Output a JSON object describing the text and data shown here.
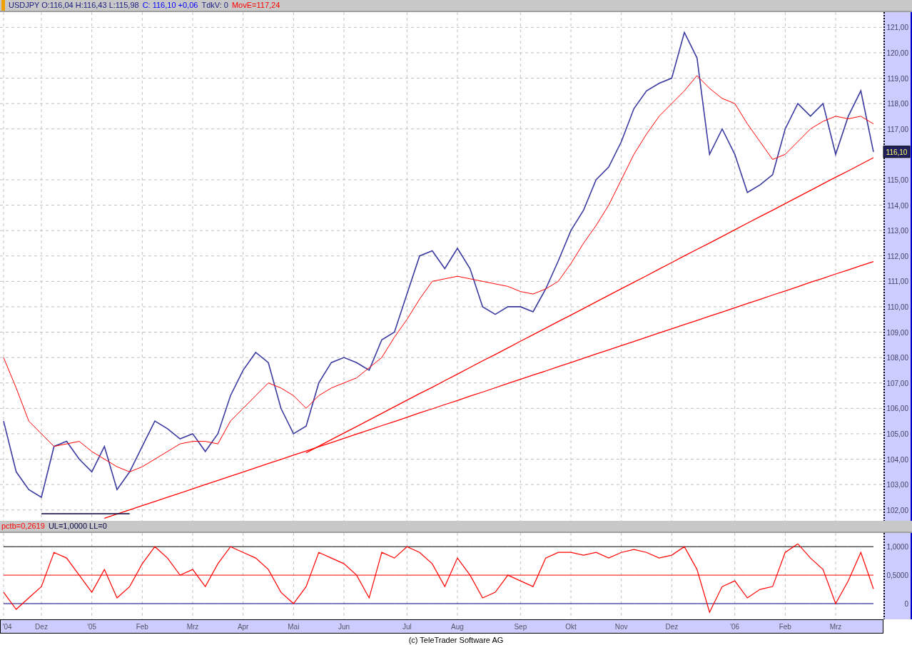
{
  "header": {
    "items": [
      {
        "text": "USDJPY O:116,04 H:116,43 L:115,98",
        "color": "#202080"
      },
      {
        "text": "C: 116,10 +0,06",
        "color": "#0000ff"
      },
      {
        "text": "TdkV: 0",
        "color": "#202080"
      },
      {
        "text": "MovE=117,24",
        "color": "#ff0000"
      }
    ]
  },
  "price_panel": {
    "last_price_tag": "116,10",
    "chart_data": {
      "type": "line",
      "grid": true,
      "series": [
        {
          "color": "#3a3aa0",
          "values": [
            105.5,
            103.5,
            102.8,
            102.5,
            104.5,
            104.7,
            104.0,
            103.5,
            104.5,
            102.8,
            103.5,
            104.5,
            105.5,
            105.2,
            104.8,
            105.0,
            104.3,
            105.0,
            106.5,
            107.5,
            108.2,
            107.8,
            106.0,
            105.0,
            105.3,
            107.0,
            107.8,
            108.0,
            107.8,
            107.5,
            108.7,
            109.0,
            110.5,
            112.0,
            112.2,
            111.5,
            112.3,
            111.5,
            110.0,
            109.7,
            110.0,
            110.0,
            109.8,
            110.7,
            111.8,
            113.0,
            113.8,
            115.0,
            115.5,
            116.5,
            117.8,
            118.5,
            118.8,
            119.0,
            120.8,
            119.8,
            116.0,
            117.0,
            116.0,
            114.5,
            114.8,
            115.2,
            117.0,
            118.0,
            117.5,
            118.0,
            116.0,
            117.5,
            118.5,
            116.1
          ]
        },
        {
          "color": "#ff0000",
          "values": [
            108,
            106.8,
            105.5,
            105,
            104.5,
            104.6,
            104.7,
            104.3,
            104,
            103.7,
            103.5,
            103.7,
            104,
            104.3,
            104.6,
            104.7,
            104.7,
            104.6,
            105.5,
            106,
            106.5,
            107,
            106.8,
            106.5,
            106,
            106.5,
            106.8,
            107,
            107.2,
            107.6,
            108,
            108.8,
            109.5,
            110.3,
            111,
            111.1,
            111.2,
            111.1,
            111,
            110.9,
            110.8,
            110.6,
            110.5,
            110.7,
            111,
            111.7,
            112.5,
            113.2,
            114,
            115,
            116,
            116.8,
            117.5,
            118,
            118.5,
            119.1,
            118.6,
            118.2,
            118,
            117.2,
            116.5,
            115.8,
            116,
            116.5,
            117,
            117.3,
            117.5,
            117.4,
            117.5,
            117.2
          ]
        },
        {
          "color": "#ff0000",
          "values": [
            null,
            null,
            null,
            null,
            null,
            null,
            null,
            null,
            101.67,
            101.84,
            102.0,
            102.17,
            102.33,
            102.5,
            102.66,
            102.83,
            103.0,
            103.16,
            103.33,
            103.49,
            103.66,
            103.83,
            103.99,
            104.16,
            104.32,
            104.49,
            104.65,
            104.82,
            104.99,
            105.15,
            105.32,
            105.48,
            105.65,
            105.82,
            105.98,
            106.15,
            106.31,
            106.48,
            106.64,
            106.81,
            106.98,
            107.14,
            107.31,
            107.47,
            107.64,
            107.8,
            107.97,
            108.14,
            108.3,
            108.47,
            108.63,
            108.8,
            108.97,
            109.13,
            109.3,
            109.46,
            109.63,
            109.79,
            109.96,
            110.13,
            110.29,
            110.46,
            110.62,
            110.79,
            110.96,
            111.12,
            111.29,
            111.45,
            111.62,
            111.78
          ]
        },
        {
          "color": "#ff0000",
          "values": [
            null,
            null,
            null,
            null,
            null,
            null,
            null,
            null,
            null,
            null,
            null,
            null,
            null,
            null,
            null,
            null,
            null,
            null,
            null,
            null,
            null,
            null,
            null,
            null,
            104.25,
            104.51,
            104.77,
            105.03,
            105.28,
            105.54,
            105.8,
            106.06,
            106.32,
            106.58,
            106.83,
            107.09,
            107.35,
            107.61,
            107.87,
            108.12,
            108.38,
            108.64,
            108.9,
            109.16,
            109.42,
            109.67,
            109.93,
            110.19,
            110.45,
            110.71,
            110.96,
            111.22,
            111.48,
            111.74,
            112.0,
            112.26,
            112.51,
            112.77,
            113.03,
            113.29,
            113.55,
            113.8,
            114.06,
            114.32,
            114.58,
            114.84,
            115.1,
            115.35,
            115.61,
            115.87
          ]
        },
        {
          "color": "#000040",
          "values": [
            null,
            null,
            null,
            101.85,
            101.85,
            101.85,
            101.85,
            101.85,
            101.85,
            101.85,
            101.85,
            null,
            null,
            null,
            null,
            null,
            null,
            null,
            null,
            null,
            null,
            null,
            null,
            null,
            null,
            null,
            null,
            null,
            null,
            null,
            null,
            null,
            null,
            null,
            null,
            null,
            null,
            null,
            null,
            null,
            null,
            null,
            null,
            null,
            null,
            null,
            null,
            null,
            null,
            null,
            null,
            null,
            null,
            null,
            null,
            null,
            null,
            null,
            null,
            null,
            null,
            null,
            null,
            null,
            null,
            null,
            null,
            null,
            null,
            null
          ]
        }
      ],
      "ylim": [
        101.57,
        121.6
      ],
      "yticks": [
        {
          "value": 102,
          "label": "102,00"
        },
        {
          "value": 103,
          "label": "103,00"
        },
        {
          "value": 104,
          "label": "104,00"
        },
        {
          "value": 105,
          "label": "105,00"
        },
        {
          "value": 106,
          "label": "106,00"
        },
        {
          "value": 107,
          "label": "107,00"
        },
        {
          "value": 108,
          "label": "108,00"
        },
        {
          "value": 109,
          "label": "109,00"
        },
        {
          "value": 110,
          "label": "110,00"
        },
        {
          "value": 111,
          "label": "111,00"
        },
        {
          "value": 112,
          "label": "112,00"
        },
        {
          "value": 113,
          "label": "113,00"
        },
        {
          "value": 114,
          "label": "114,00"
        },
        {
          "value": 115,
          "label": "115,00"
        },
        {
          "value": 117,
          "label": "117,00"
        },
        {
          "value": 118,
          "label": "118,00"
        },
        {
          "value": 119,
          "label": "119,00"
        },
        {
          "value": 120,
          "label": "120,00"
        },
        {
          "value": 121,
          "label": "121,00"
        }
      ]
    }
  },
  "indicator_header": {
    "items": [
      {
        "text": "pctb=0,2619",
        "color": "#ff0000"
      },
      {
        "text": "UL=1,0000 LL=0",
        "color": "#000040"
      }
    ]
  },
  "indicator_panel": {
    "chart_data": {
      "type": "line",
      "grid": true,
      "categories": [
        "'04",
        null,
        null,
        "Dez",
        null,
        null,
        null,
        "'05",
        null,
        null,
        null,
        "Feb",
        null,
        null,
        null,
        "Mrz",
        null,
        null,
        null,
        "Apr",
        null,
        null,
        null,
        "Mai",
        null,
        null,
        null,
        "Jun",
        null,
        null,
        null,
        null,
        "Jul",
        null,
        null,
        null,
        "Aug",
        null,
        null,
        null,
        null,
        "Sep",
        null,
        null,
        null,
        "Okt",
        null,
        null,
        null,
        "Nov",
        null,
        null,
        null,
        "Dez",
        null,
        null,
        null,
        null,
        "'06",
        null,
        null,
        null,
        "Feb",
        null,
        null,
        null,
        "Mrz",
        null,
        null,
        null
      ],
      "series": [
        {
          "color": "#ff0000",
          "values": [
            0.2,
            -0.1,
            0.1,
            0.3,
            0.9,
            0.8,
            0.5,
            0.2,
            0.6,
            0.1,
            0.3,
            0.7,
            1.0,
            0.8,
            0.5,
            0.6,
            0.3,
            0.7,
            1.0,
            0.9,
            0.8,
            0.6,
            0.2,
            0.0,
            0.3,
            0.9,
            0.8,
            0.7,
            0.5,
            0.1,
            0.9,
            0.8,
            1.0,
            0.9,
            0.7,
            0.3,
            0.8,
            0.5,
            0.1,
            0.2,
            0.5,
            0.4,
            0.3,
            0.8,
            0.9,
            0.9,
            0.85,
            0.9,
            0.8,
            0.9,
            0.95,
            0.9,
            0.8,
            0.85,
            1.0,
            0.6,
            -0.15,
            0.3,
            0.4,
            0.1,
            0.25,
            0.3,
            0.9,
            1.05,
            0.8,
            0.6,
            0.0,
            0.4,
            0.9,
            0.26
          ]
        },
        {
          "color": "#000000",
          "values": [
            1,
            1,
            1,
            1,
            1,
            1,
            1,
            1,
            1,
            1,
            1,
            1,
            1,
            1,
            1,
            1,
            1,
            1,
            1,
            1,
            1,
            1,
            1,
            1,
            1,
            1,
            1,
            1,
            1,
            1,
            1,
            1,
            1,
            1,
            1,
            1,
            1,
            1,
            1,
            1,
            1,
            1,
            1,
            1,
            1,
            1,
            1,
            1,
            1,
            1,
            1,
            1,
            1,
            1,
            1,
            1,
            1,
            1,
            1,
            1,
            1,
            1,
            1,
            1,
            1,
            1,
            1,
            1,
            1,
            1
          ]
        },
        {
          "color": "#ff0000",
          "values": [
            0.5,
            0.5,
            0.5,
            0.5,
            0.5,
            0.5,
            0.5,
            0.5,
            0.5,
            0.5,
            0.5,
            0.5,
            0.5,
            0.5,
            0.5,
            0.5,
            0.5,
            0.5,
            0.5,
            0.5,
            0.5,
            0.5,
            0.5,
            0.5,
            0.5,
            0.5,
            0.5,
            0.5,
            0.5,
            0.5,
            0.5,
            0.5,
            0.5,
            0.5,
            0.5,
            0.5,
            0.5,
            0.5,
            0.5,
            0.5,
            0.5,
            0.5,
            0.5,
            0.5,
            0.5,
            0.5,
            0.5,
            0.5,
            0.5,
            0.5,
            0.5,
            0.5,
            0.5,
            0.5,
            0.5,
            0.5,
            0.5,
            0.5,
            0.5,
            0.5,
            0.5,
            0.5,
            0.5,
            0.5,
            0.5,
            0.5,
            0.5,
            0.5,
            0.5,
            0.5
          ]
        },
        {
          "color": "#000080",
          "values": [
            0,
            0,
            0,
            0,
            0,
            0,
            0,
            0,
            0,
            0,
            0,
            0,
            0,
            0,
            0,
            0,
            0,
            0,
            0,
            0,
            0,
            0,
            0,
            0,
            0,
            0,
            0,
            0,
            0,
            0,
            0,
            0,
            0,
            0,
            0,
            0,
            0,
            0,
            0,
            0,
            0,
            0,
            0,
            0,
            0,
            0,
            0,
            0,
            0,
            0,
            0,
            0,
            0,
            0,
            0,
            0,
            0,
            0,
            0,
            0,
            0,
            0,
            0,
            0,
            0,
            0,
            0,
            0,
            0,
            0
          ]
        }
      ],
      "ylim": [
        -0.275,
        1.24
      ],
      "yticks": [
        {
          "value": 0,
          "label": "0"
        },
        {
          "value": 0.5,
          "label": "0,5000"
        },
        {
          "value": 1,
          "label": "1,0000"
        }
      ]
    }
  },
  "footer": "(c) TeleTrader Software AG"
}
